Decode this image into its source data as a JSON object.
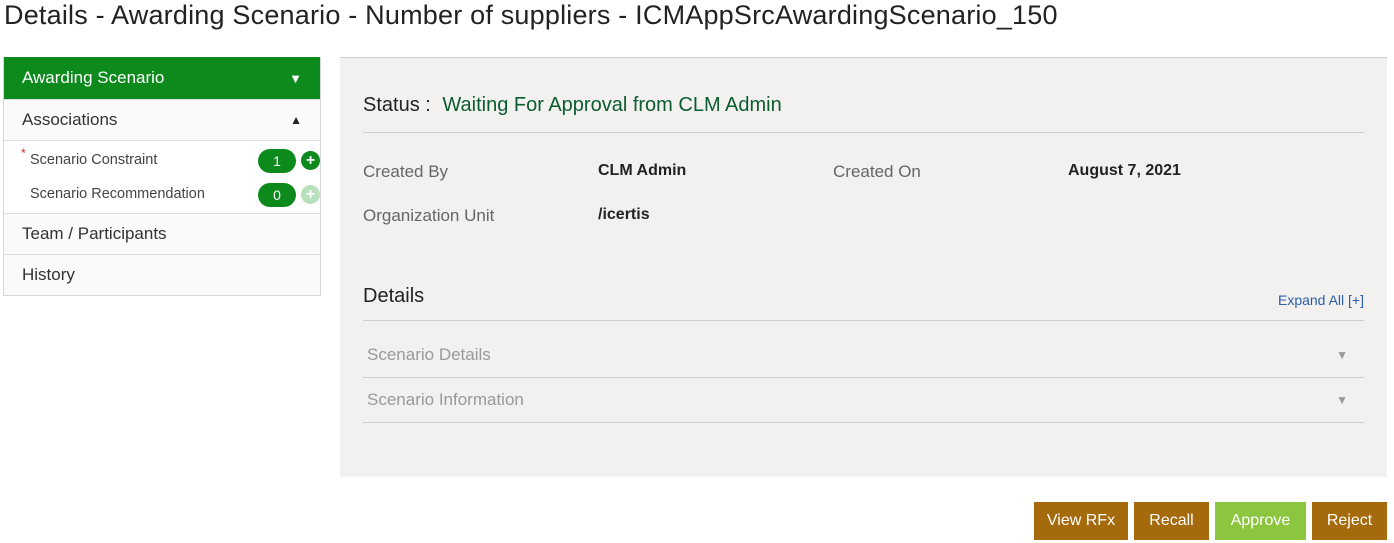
{
  "page": {
    "title": "Details - Awarding Scenario - Number of suppliers - ICMAppSrcAwardingScenario_150"
  },
  "sidebar": {
    "header": "Awarding Scenario",
    "associations_label": "Associations",
    "associations": [
      {
        "label": "Scenario Constraint",
        "count": "1",
        "required": true
      },
      {
        "label": "Scenario Recommendation",
        "count": "0",
        "required": false
      }
    ],
    "items": [
      {
        "label": "Team / Participants"
      },
      {
        "label": "History"
      }
    ],
    "required_mark": "*"
  },
  "status": {
    "label": "Status :",
    "value": "Waiting For Approval from CLM Admin"
  },
  "info": {
    "created_by_label": "Created By",
    "created_by_value": "CLM Admin",
    "created_on_label": "Created On",
    "created_on_value": "August 7, 2021",
    "org_unit_label": "Organization Unit",
    "org_unit_value": "/icertis"
  },
  "details": {
    "title": "Details",
    "expand_all": "Expand All [+]",
    "sections": [
      {
        "label": "Scenario Details"
      },
      {
        "label": "Scenario Information"
      }
    ]
  },
  "actions": {
    "view_rfx": "View RFx",
    "recall": "Recall",
    "approve": "Approve",
    "reject": "Reject"
  },
  "colors": {
    "primary_green": "#0d8a1c",
    "status_green": "#0b5c2e",
    "action_brown": "#a56a0c",
    "approve_green": "#8cc63f",
    "link_blue": "#2a5ea8"
  },
  "icons": {
    "sidebar_header_caret": "▼",
    "associations_caret": "▲",
    "add": "+",
    "accordion_caret": "▼"
  }
}
